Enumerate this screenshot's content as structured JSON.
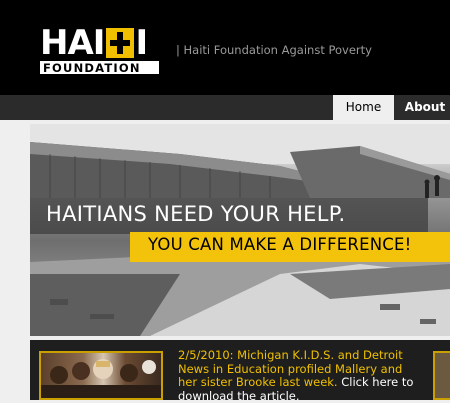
{
  "header": {
    "logo": {
      "top_left": "HA",
      "top_i_left": "I",
      "top_right": "I",
      "bottom": "FOUNDATION"
    },
    "tagline": "| Haiti Foundation Against Poverty"
  },
  "nav": {
    "tabs": [
      {
        "label": "Home",
        "active": true
      },
      {
        "label": "About",
        "active": false
      }
    ]
  },
  "hero": {
    "headline": "HAITIANS NEED YOUR HELP.",
    "cta": "YOU CAN MAKE A DIFFERENCE!"
  },
  "news": {
    "text_1": "2/5/2010: Michigan K.I.D.S. and Detroit News in Education profiled Mallery and her sister Brooke last week. ",
    "link_1": "Click here to",
    "link_2": "download the article."
  },
  "colors": {
    "accent": "#f3c20b",
    "header_bg": "#000000",
    "nav_bg": "#2b2b2b",
    "page_bg": "#efefef"
  }
}
